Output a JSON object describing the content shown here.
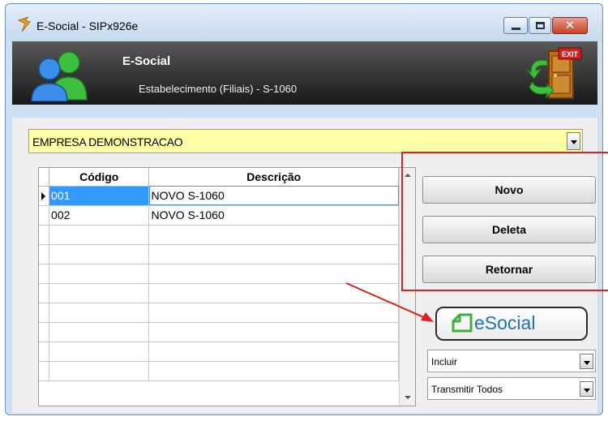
{
  "window": {
    "title": "E-Social - SIPx926e",
    "colors": {
      "title_bg": "#c6d9ee",
      "close_btn": "#c7402a"
    }
  },
  "header": {
    "title": "E-Social",
    "subtitle": "Estabelecimento (Filiais) - S-1060",
    "icons": {
      "left": "users-icon",
      "right": "exit-door-icon"
    },
    "exit_badge": "EXIT"
  },
  "company": {
    "selected": "EMPRESA DEMONSTRACAO",
    "bg_color": "#ffffa8"
  },
  "grid": {
    "columns": [
      "Código",
      "Descrição"
    ],
    "rows": [
      {
        "codigo": "001",
        "descricao": "NOVO S-1060",
        "selected": true
      },
      {
        "codigo": "002",
        "descricao": "NOVO S-1060",
        "selected": false
      }
    ]
  },
  "actions": {
    "novo": "Novo",
    "deleta": "Deleta",
    "retornar": "Retornar"
  },
  "esocial": {
    "label": "eSocial",
    "action_select": "Incluir",
    "transmit_select": "Transmitir Todos"
  },
  "annotation": {
    "color": "#e02020"
  }
}
